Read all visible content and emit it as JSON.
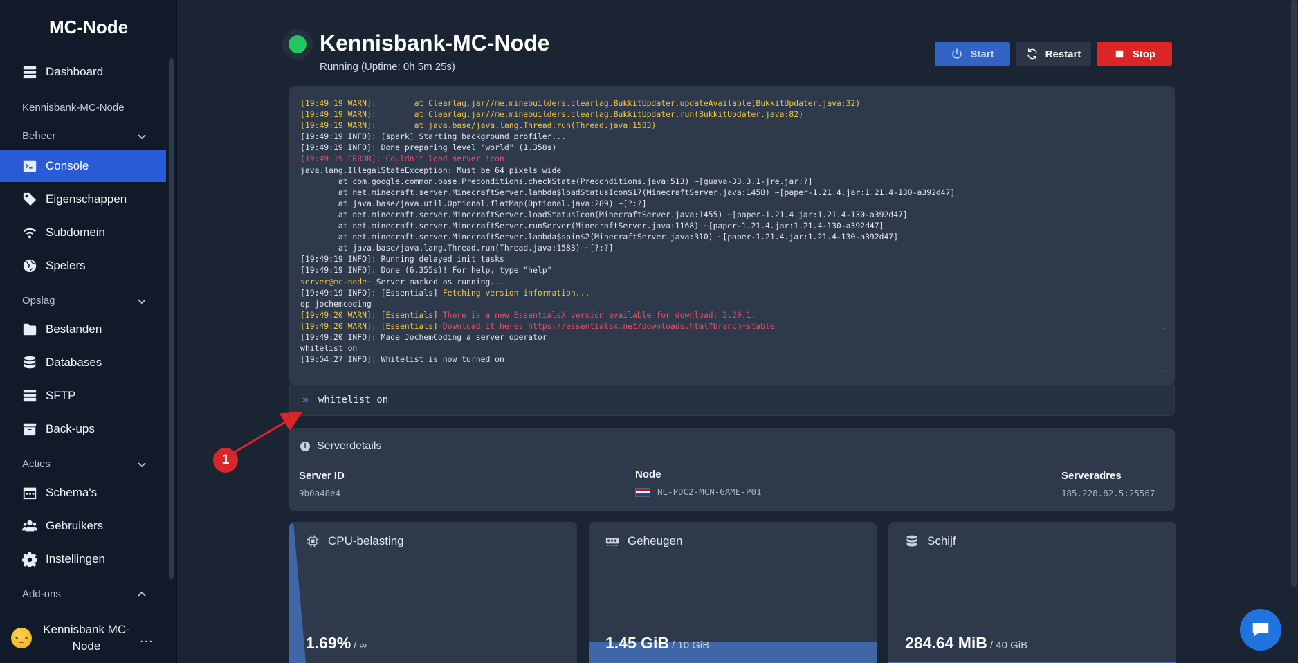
{
  "sidebar": {
    "brand": "MC-Node",
    "dashboard": "Dashboard",
    "server_name": "Kennisbank-MC-Node",
    "sections": {
      "beheer": "Beheer",
      "opslag": "Opslag",
      "acties": "Acties",
      "addons": "Add-ons"
    },
    "beheer_items": [
      "Console",
      "Eigenschappen",
      "Subdomein",
      "Spelers"
    ],
    "opslag_items": [
      "Bestanden",
      "Databases",
      "SFTP",
      "Back-ups"
    ],
    "acties_items": [
      "Schema's",
      "Gebruikers",
      "Instellingen"
    ],
    "user": {
      "name": "Kennisbank MC-Node",
      "more": "..."
    }
  },
  "header": {
    "title": "Kennisbank-MC-Node",
    "status": "Running (Uptime: 0h 5m 25s)",
    "start_label": "Start",
    "restart_label": "Restart",
    "stop_label": "Stop"
  },
  "console": {
    "lines": [
      {
        "type": "warn",
        "text": "[19:49:19 WARN]:        at Clearlag.jar//me.minebuilders.clearlag.BukkitUpdater.updateAvailable(BukkitUpdater.java:32)"
      },
      {
        "type": "warn",
        "text": "[19:49:19 WARN]:        at Clearlag.jar//me.minebuilders.clearlag.BukkitUpdater.run(BukkitUpdater.java:82)"
      },
      {
        "type": "warn",
        "text": "[19:49:19 WARN]:        at java.base/java.lang.Thread.run(Thread.java:1583)"
      },
      {
        "type": "info",
        "text": "[19:49:19 INFO]: [spark] Starting background profiler..."
      },
      {
        "type": "info",
        "text": "[19:49:19 INFO]: Done preparing level \"world\" (1.358s)"
      },
      {
        "type": "err",
        "text": "[19:49:19 ERROR]: Couldn't load server icon"
      },
      {
        "type": "info",
        "text": "java.lang.IllegalStateException: Must be 64 pixels wide"
      },
      {
        "type": "info",
        "text": "        at com.google.common.base.Preconditions.checkState(Preconditions.java:513) ~[guava-33.3.1-jre.jar:?]"
      },
      {
        "type": "info",
        "text": "        at net.minecraft.server.MinecraftServer.lambda$loadStatusIcon$17(MinecraftServer.java:1458) ~[paper-1.21.4.jar:1.21.4-130-a392d47]"
      },
      {
        "type": "info",
        "text": "        at java.base/java.util.Optional.flatMap(Optional.java:289) ~[?:?]"
      },
      {
        "type": "info",
        "text": "        at net.minecraft.server.MinecraftServer.loadStatusIcon(MinecraftServer.java:1455) ~[paper-1.21.4.jar:1.21.4-130-a392d47]"
      },
      {
        "type": "info",
        "text": "        at net.minecraft.server.MinecraftServer.runServer(MinecraftServer.java:1168) ~[paper-1.21.4.jar:1.21.4-130-a392d47]"
      },
      {
        "type": "info",
        "text": "        at net.minecraft.server.MinecraftServer.lambda$spin$2(MinecraftServer.java:310) ~[paper-1.21.4.jar:1.21.4-130-a392d47]"
      },
      {
        "type": "info",
        "text": "        at java.base/java.lang.Thread.run(Thread.java:1583) ~[?:?]"
      },
      {
        "type": "info",
        "text": "[19:49:19 INFO]: Running delayed init tasks"
      },
      {
        "type": "info",
        "text": "[19:49:19 INFO]: Done (6.355s)! For help, type \"help\""
      },
      {
        "type": "prompt",
        "prompt": "server@mc-node~",
        "text": " Server marked as running..."
      },
      {
        "type": "mixed_warn",
        "prefix": "[19:49:19 INFO]: [Essentials] ",
        "text": "Fetching version information..."
      },
      {
        "type": "info",
        "text": "op jochemcoding"
      },
      {
        "type": "mixed_err",
        "prefix": "[19:49:20 WARN]: [Essentials] ",
        "text": "There is a new EssentialsX version available for download: 2.20.1."
      },
      {
        "type": "mixed_err",
        "prefix": "[19:49:20 WARN]: [Essentials] ",
        "text": "Download it here: https://essentialsx.net/downloads.html?branch=stable"
      },
      {
        "type": "info",
        "text": "[19:49:20 INFO]: Made JochemCoding a server operator"
      },
      {
        "type": "info",
        "text": "whitelist on"
      },
      {
        "type": "info",
        "text": "[19:54:27 INFO]: Whitelist is now turned on"
      }
    ],
    "command_value": "whitelist on",
    "command_icon": "double-chevron-right-icon"
  },
  "annotation": {
    "badge": "1"
  },
  "details": {
    "title": "Serverdetails",
    "server_id_label": "Server ID",
    "server_id": "9b0a48e4",
    "node_label": "Node",
    "node": "NL-PDC2-MCN-GAME-P01",
    "address_label": "Serveradres",
    "address": "185.228.82.5:25567"
  },
  "stats": {
    "cpu": {
      "label": "CPU-belasting",
      "value": "1.69%",
      "limit": "/ ∞"
    },
    "memory": {
      "label": "Geheugen",
      "value": "1.45 GiB",
      "limit": "/ 10 GiB",
      "fill": 0.145
    },
    "disk": {
      "label": "Schijf",
      "value": "284.64 MiB",
      "limit": "/ 40 GiB",
      "fill": 0.007
    }
  },
  "colors": {
    "accent": "#2a5bd7",
    "running": "#22c55e",
    "stop": "#dc2626",
    "warn": "#f2c744",
    "error": "#f04d63"
  }
}
